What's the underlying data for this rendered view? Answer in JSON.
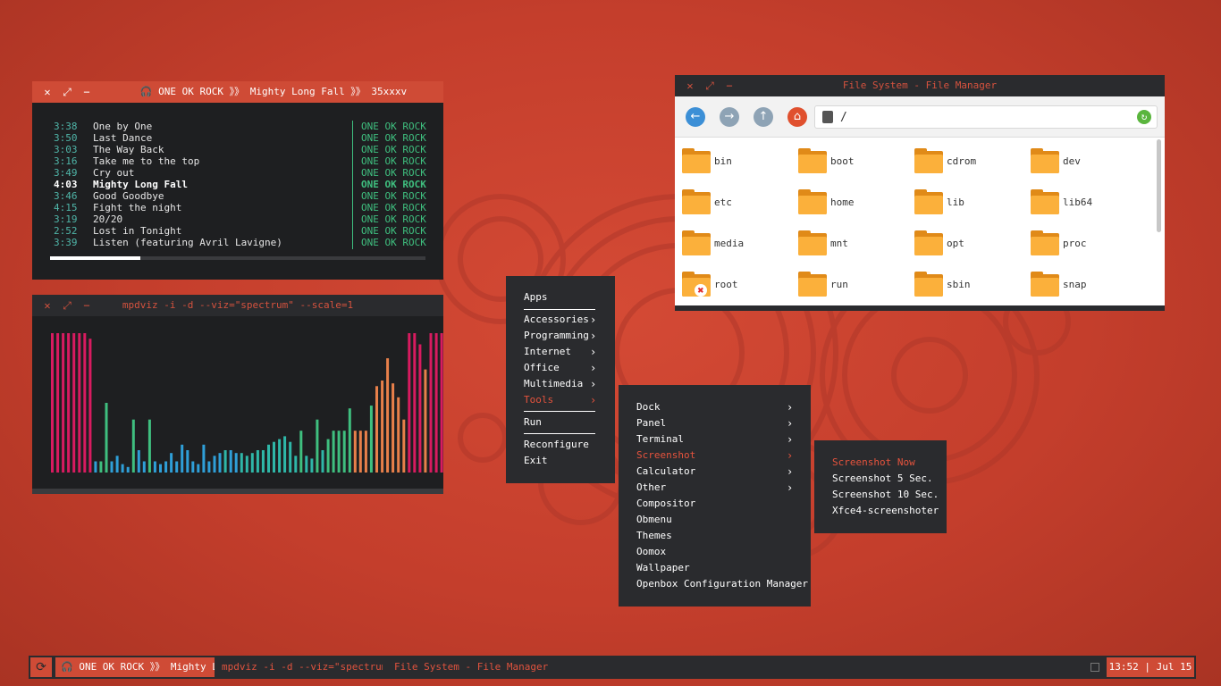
{
  "colors": {
    "accent": "#cf4b36",
    "panel": "#2a2b2e",
    "terminal_bg": "#1e1f21",
    "artist_green": "#3fbf7f",
    "time_teal": "#4fb5a8",
    "viz_pink": "#d81b60",
    "viz_blue": "#2f9fd8",
    "viz_teal": "#2fb7a8",
    "viz_green": "#3fbf7f",
    "viz_orange": "#e8804a",
    "folder": "#fbb03b"
  },
  "music_window": {
    "buttons": {
      "close": "✕",
      "maximize": "⤢",
      "minimize": "−"
    },
    "title": "🎧 ONE OK ROCK 》》 Mighty Long Fall 》》 35xxxv",
    "progress": 0.24,
    "tracks": [
      {
        "time": "3:38",
        "title": "One by One",
        "artist": "ONE OK ROCK"
      },
      {
        "time": "3:50",
        "title": "Last Dance",
        "artist": "ONE OK ROCK"
      },
      {
        "time": "3:03",
        "title": "The Way Back",
        "artist": "ONE OK ROCK"
      },
      {
        "time": "3:16",
        "title": "Take me to the top",
        "artist": "ONE OK ROCK"
      },
      {
        "time": "3:49",
        "title": "Cry out",
        "artist": "ONE OK ROCK"
      },
      {
        "time": "4:03",
        "title": "Mighty Long Fall",
        "artist": "ONE OK ROCK",
        "current": true
      },
      {
        "time": "3:46",
        "title": "Good Goodbye",
        "artist": "ONE OK ROCK"
      },
      {
        "time": "4:15",
        "title": "Fight the night",
        "artist": "ONE OK ROCK"
      },
      {
        "time": "3:19",
        "title": "20/20",
        "artist": "ONE OK ROCK"
      },
      {
        "time": "2:52",
        "title": "Lost in Tonight",
        "artist": "ONE OK ROCK"
      },
      {
        "time": "3:39",
        "title": "Listen (featuring Avril Lavigne)",
        "artist": "ONE OK ROCK"
      }
    ]
  },
  "viz_window": {
    "buttons": {
      "close": "✕",
      "maximize": "⤢",
      "minimize": "−"
    },
    "title": "mpdviz -i -d --viz=\"spectrum\" --scale=1",
    "levels": [
      1.0,
      1.0,
      1.0,
      1.0,
      1.0,
      1.0,
      1.0,
      0.96,
      0.08,
      0.08,
      0.5,
      0.08,
      0.12,
      0.06,
      0.04,
      0.38,
      0.16,
      0.08,
      0.38,
      0.08,
      0.06,
      0.08,
      0.14,
      0.08,
      0.2,
      0.16,
      0.08,
      0.06,
      0.2,
      0.08,
      0.12,
      0.14,
      0.16,
      0.16,
      0.14,
      0.14,
      0.12,
      0.14,
      0.16,
      0.16,
      0.2,
      0.22,
      0.24,
      0.26,
      0.22,
      0.12,
      0.3,
      0.12,
      0.1,
      0.38,
      0.16,
      0.24,
      0.3,
      0.3,
      0.3,
      0.46,
      0.3,
      0.3,
      0.3,
      0.48,
      0.62,
      0.66,
      0.82,
      0.64,
      0.54,
      0.38,
      1.0,
      1.0,
      0.92,
      0.74,
      1.0,
      1.0,
      1.0,
      1.0,
      1.0,
      0.83
    ],
    "bar_colors": [
      "pink",
      "pink",
      "pink",
      "pink",
      "pink",
      "pink",
      "pink",
      "pink",
      "blue",
      "green",
      "green",
      "blue",
      "blue",
      "blue",
      "blue",
      "green",
      "blue",
      "blue",
      "green",
      "blue",
      "blue",
      "blue",
      "blue",
      "blue",
      "blue",
      "blue",
      "blue",
      "blue",
      "blue",
      "blue",
      "blue",
      "blue",
      "teal",
      "blue",
      "blue",
      "teal",
      "teal",
      "teal",
      "teal",
      "teal",
      "teal",
      "teal",
      "teal",
      "teal",
      "teal",
      "teal",
      "green",
      "teal",
      "teal",
      "green",
      "teal",
      "green",
      "green",
      "green",
      "green",
      "green",
      "orange",
      "orange",
      "orange",
      "green",
      "orange",
      "orange",
      "orange",
      "orange",
      "orange",
      "orange",
      "pink",
      "pink",
      "pink",
      "orange",
      "pink",
      "pink",
      "pink",
      "pink",
      "pink",
      "pink"
    ]
  },
  "file_manager": {
    "buttons": {
      "close": "✕",
      "maximize": "⤢",
      "minimize": "−"
    },
    "title": "File System - File Manager",
    "nav": {
      "back": "←",
      "forward": "→",
      "up": "↑",
      "home": "⌂"
    },
    "path": "/",
    "refresh": "↻",
    "folders": [
      "bin",
      "boot",
      "cdrom",
      "dev",
      "etc",
      "home",
      "lib",
      "lib64",
      "media",
      "mnt",
      "opt",
      "proc",
      "root",
      "run",
      "sbin",
      "snap"
    ],
    "locked_badge": "✖"
  },
  "menu_main": {
    "header": "Apps",
    "items": [
      {
        "label": "Accessories",
        "arrow": "›"
      },
      {
        "label": "Programming",
        "arrow": "›"
      },
      {
        "label": "Internet",
        "arrow": "›"
      },
      {
        "label": "Office",
        "arrow": "›"
      },
      {
        "label": "Multimedia",
        "arrow": "›"
      },
      {
        "label": "Tools",
        "arrow": "›",
        "active": true
      }
    ],
    "footer": [
      "Run",
      "Reconfigure",
      "Exit"
    ]
  },
  "menu_tools": {
    "items": [
      {
        "label": "Dock",
        "arrow": "›"
      },
      {
        "label": "Panel",
        "arrow": "›"
      },
      {
        "label": "Terminal",
        "arrow": "›"
      },
      {
        "label": "Screenshot",
        "arrow": "›",
        "active": true
      },
      {
        "label": "Calculator",
        "arrow": "›"
      },
      {
        "label": "Other",
        "arrow": "›"
      },
      {
        "label": "Compositor"
      },
      {
        "label": "Obmenu"
      },
      {
        "label": "Themes"
      },
      {
        "label": "Oomox"
      },
      {
        "label": "Wallpaper"
      },
      {
        "label": "Openbox Configuration Manager"
      }
    ]
  },
  "menu_screenshot": {
    "items": [
      {
        "label": "Screenshot Now",
        "active": true
      },
      {
        "label": "Screenshot 5 Sec."
      },
      {
        "label": "Screenshot 10 Sec."
      },
      {
        "label": "Xfce4-screenshoter"
      }
    ]
  },
  "taskbar": {
    "start_icon": "⟳",
    "tasks": [
      {
        "label": "🎧 ONE OK ROCK 》》 Mighty Lon…",
        "active": true
      },
      {
        "label": "mpdviz -i -d --viz=\"spectrum…",
        "active": false
      },
      {
        "label": "File System - File Manager",
        "active": false
      }
    ],
    "clock": "13:52 | Jul 15"
  }
}
